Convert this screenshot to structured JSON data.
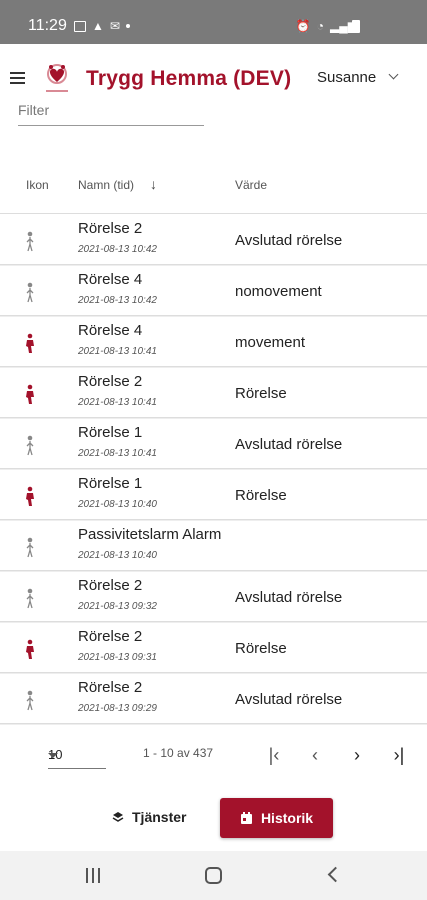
{
  "status_bar": {
    "time": "11:29"
  },
  "app_bar": {
    "title": "Trygg Hemma (DEV)",
    "user": "Susanne"
  },
  "filter": {
    "label": "Filter"
  },
  "table": {
    "headers": {
      "icon": "Ikon",
      "name": "Namn (tid)",
      "value": "Värde"
    },
    "rows": [
      {
        "name": "Rörelse 2",
        "time": "2021-08-13 10:42",
        "value": "Avslutad rörelse",
        "icon": "person-idle-icon"
      },
      {
        "name": "Rörelse 4",
        "time": "2021-08-13 10:42",
        "value": "nomovement",
        "icon": "person-idle-icon"
      },
      {
        "name": "Rörelse 4",
        "time": "2021-08-13 10:41",
        "value": "movement",
        "icon": "person-active-icon"
      },
      {
        "name": "Rörelse 2",
        "time": "2021-08-13 10:41",
        "value": "Rörelse",
        "icon": "person-active-icon"
      },
      {
        "name": "Rörelse 1",
        "time": "2021-08-13 10:41",
        "value": "Avslutad rörelse",
        "icon": "person-idle-icon"
      },
      {
        "name": "Rörelse 1",
        "time": "2021-08-13 10:40",
        "value": "Rörelse",
        "icon": "person-active-icon"
      },
      {
        "name": "Passivitetslarm Alarm",
        "time": "2021-08-13 10:40",
        "value": "",
        "icon": "person-idle-icon"
      },
      {
        "name": "Rörelse 2",
        "time": "2021-08-13 09:32",
        "value": "Avslutad rörelse",
        "icon": "person-idle-icon"
      },
      {
        "name": "Rörelse 2",
        "time": "2021-08-13 09:31",
        "value": "Rörelse",
        "icon": "person-active-icon"
      },
      {
        "name": "Rörelse 2",
        "time": "2021-08-13 09:29",
        "value": "Avslutad rörelse",
        "icon": "person-idle-icon"
      }
    ]
  },
  "paginator": {
    "page_size": "10",
    "range": "1 - 10 av 437"
  },
  "actions": {
    "services_label": "Tjänster",
    "history_label": "Historik"
  },
  "colors": {
    "brand": "#a3122b",
    "status_bar": "#7a7a7a",
    "nav_bar": "#f2f2f2"
  }
}
